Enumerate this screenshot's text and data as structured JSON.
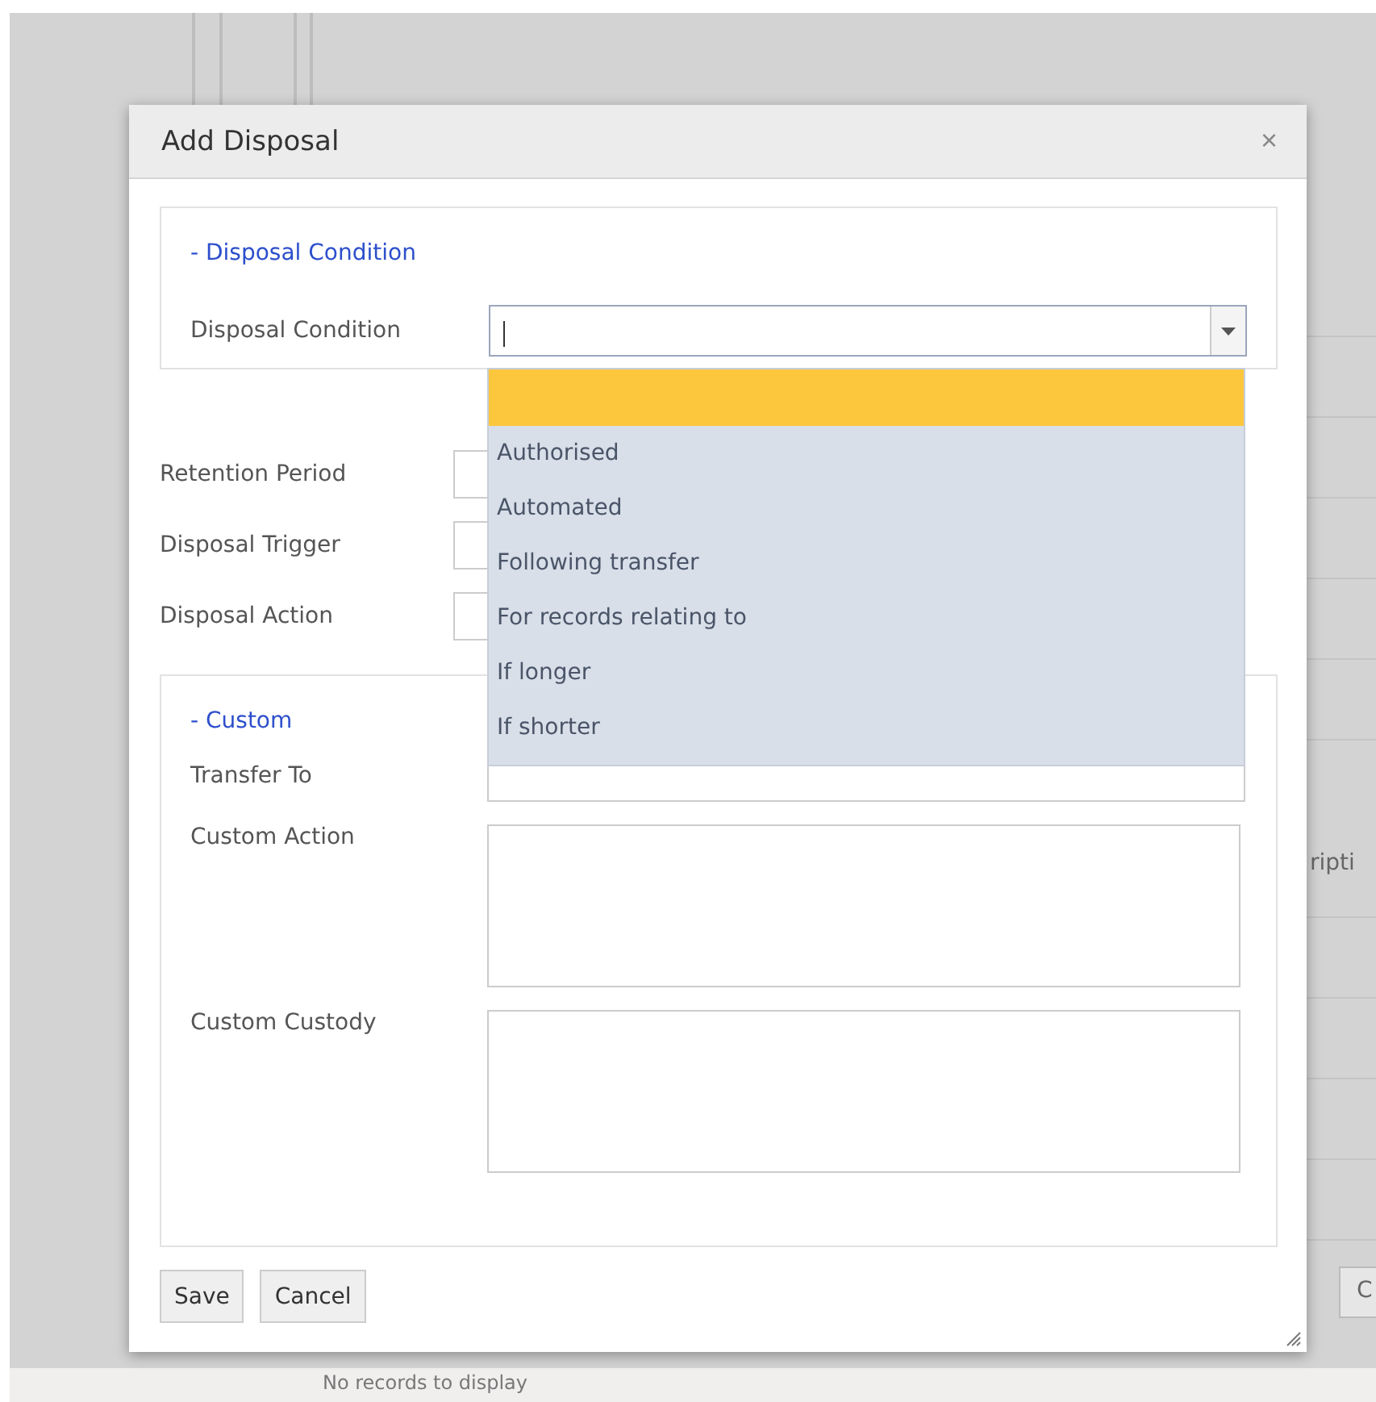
{
  "background": {
    "column_fragment": "ripti",
    "button_fragment": "C",
    "empty_message": "No records to display"
  },
  "dialog": {
    "title": "Add Disposal",
    "close": "×",
    "condition_section": {
      "legend": "- Disposal Condition",
      "label": "Disposal Condition",
      "dropdown": {
        "expanded": true,
        "blank_option_highlighted": true,
        "options": [
          {
            "label": "Authorised",
            "selected": false
          },
          {
            "label": "Automated",
            "selected": false
          },
          {
            "label": "Following transfer",
            "selected": false
          },
          {
            "label": "For records relating to",
            "selected": false
          },
          {
            "label": "If longer",
            "selected": false
          },
          {
            "label": "If shorter",
            "selected": false
          }
        ]
      }
    },
    "fields": [
      {
        "label": "Retention Period"
      },
      {
        "label": "Disposal Trigger"
      },
      {
        "label": "Disposal Action"
      }
    ],
    "custom_section": {
      "legend": "- Custom",
      "fields": [
        {
          "label": "Transfer To",
          "kind": "input"
        },
        {
          "label": "Custom Action",
          "kind": "textarea"
        },
        {
          "label": "Custom Custody",
          "kind": "textarea"
        }
      ]
    },
    "buttons": [
      "Save",
      "Cancel"
    ]
  }
}
